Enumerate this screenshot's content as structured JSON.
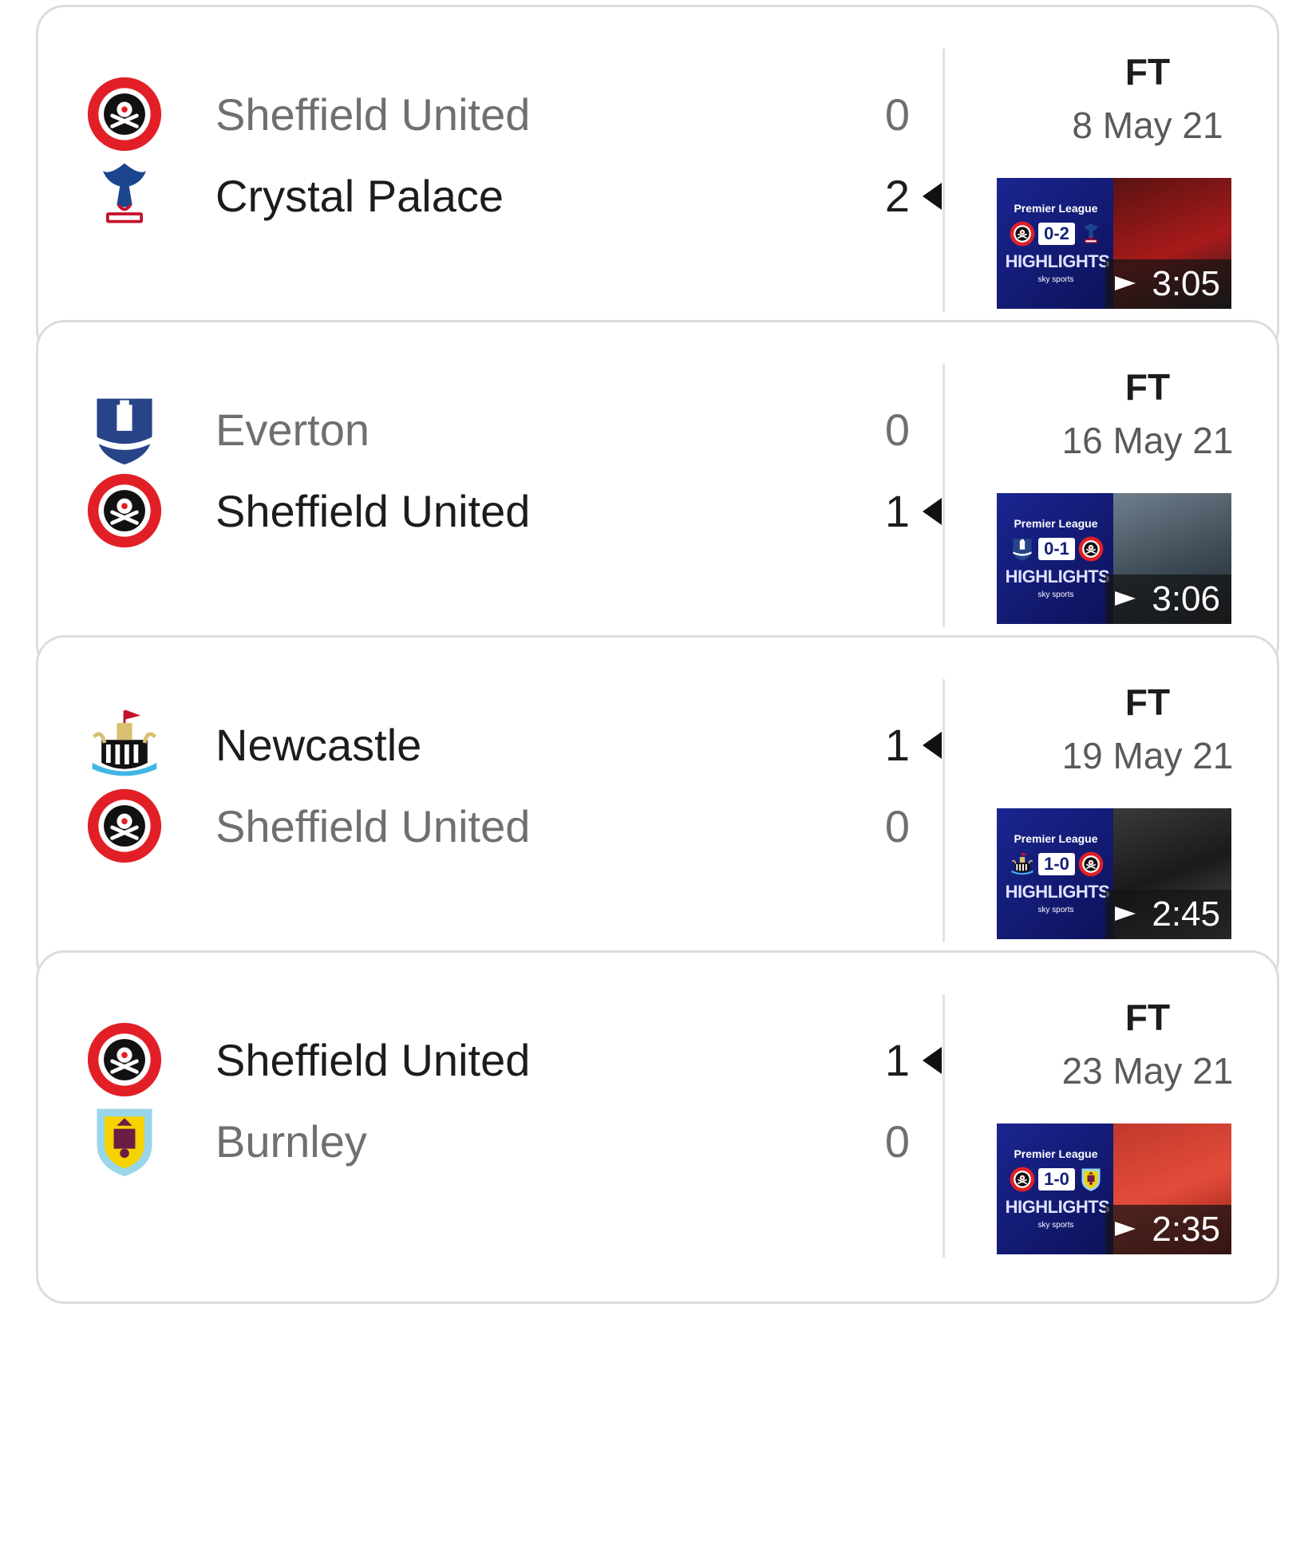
{
  "matches": [
    {
      "home": {
        "name": "Sheffield United",
        "score": "0",
        "winner": false,
        "crest": "sheffield-united-crest-icon"
      },
      "away": {
        "name": "Crystal Palace",
        "score": "2",
        "winner": true,
        "crest": "crystal-palace-crest-icon"
      },
      "status": "FT",
      "date": "8 May 21",
      "highlight": {
        "duration": "3:05",
        "scoreline": "0-2",
        "league": "Premier League",
        "label": "HIGHLIGHTS",
        "broadcaster": "sky sports"
      }
    },
    {
      "home": {
        "name": "Everton",
        "score": "0",
        "winner": false,
        "crest": "everton-crest-icon"
      },
      "away": {
        "name": "Sheffield United",
        "score": "1",
        "winner": true,
        "crest": "sheffield-united-crest-icon"
      },
      "status": "FT",
      "date": "16 May 21",
      "highlight": {
        "duration": "3:06",
        "scoreline": "0-1",
        "league": "Premier League",
        "label": "HIGHLIGHTS",
        "broadcaster": "sky sports"
      }
    },
    {
      "home": {
        "name": "Newcastle",
        "score": "1",
        "winner": true,
        "crest": "newcastle-crest-icon"
      },
      "away": {
        "name": "Sheffield United",
        "score": "0",
        "winner": false,
        "crest": "sheffield-united-crest-icon"
      },
      "status": "FT",
      "date": "19 May 21",
      "highlight": {
        "duration": "2:45",
        "scoreline": "1-0",
        "league": "Premier League",
        "label": "HIGHLIGHTS",
        "broadcaster": "sky sports"
      }
    },
    {
      "home": {
        "name": "Sheffield United",
        "score": "1",
        "winner": true,
        "crest": "sheffield-united-crest-icon"
      },
      "away": {
        "name": "Burnley",
        "score": "0",
        "winner": false,
        "crest": "burnley-crest-icon"
      },
      "status": "FT",
      "date": "23 May 21",
      "highlight": {
        "duration": "2:35",
        "scoreline": "1-0",
        "league": "Premier League",
        "label": "HIGHLIGHTS",
        "broadcaster": "sky sports"
      }
    }
  ],
  "colors": {
    "winner_text": "#1c1c1c",
    "loser_text": "#6f6f6f",
    "card_border": "#dcdcdc",
    "thumb_blue": "#16207a"
  }
}
